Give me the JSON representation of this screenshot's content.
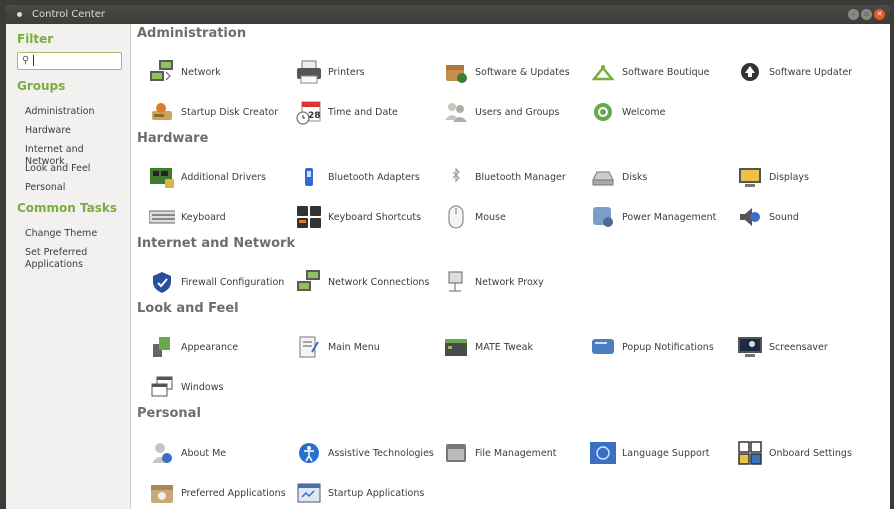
{
  "window": {
    "title": "Control Center"
  },
  "sidebar": {
    "filter_heading": "Filter",
    "search_value": "",
    "groups_heading": "Groups",
    "groups": [
      "Administration",
      "Hardware",
      "Internet and Network",
      "Look and Feel",
      "Personal"
    ],
    "tasks_heading": "Common Tasks",
    "tasks": [
      "Change Theme",
      "Set Preferred Applications"
    ]
  },
  "sections": [
    {
      "title": "Administration",
      "items": [
        {
          "label": "Network",
          "icon": "network-icon"
        },
        {
          "label": "Printers",
          "icon": "printer-icon"
        },
        {
          "label": "Software & Updates",
          "icon": "software-updates-icon"
        },
        {
          "label": "Software Boutique",
          "icon": "boutique-icon"
        },
        {
          "label": "Software Updater",
          "icon": "updater-icon"
        },
        {
          "label": "Startup Disk Creator",
          "icon": "startup-disk-icon"
        },
        {
          "label": "Time and Date",
          "icon": "calendar-clock-icon"
        },
        {
          "label": "Users and Groups",
          "icon": "users-icon"
        },
        {
          "label": "Welcome",
          "icon": "welcome-icon"
        }
      ]
    },
    {
      "title": "Hardware",
      "items": [
        {
          "label": "Additional Drivers",
          "icon": "drivers-icon"
        },
        {
          "label": "Bluetooth Adapters",
          "icon": "bluetooth-adapter-icon"
        },
        {
          "label": "Bluetooth Manager",
          "icon": "bluetooth-icon"
        },
        {
          "label": "Disks",
          "icon": "disks-icon"
        },
        {
          "label": "Displays",
          "icon": "display-icon"
        },
        {
          "label": "Keyboard",
          "icon": "keyboard-icon"
        },
        {
          "label": "Keyboard Shortcuts",
          "icon": "shortcuts-icon"
        },
        {
          "label": "Mouse",
          "icon": "mouse-icon"
        },
        {
          "label": "Power Management",
          "icon": "power-icon"
        },
        {
          "label": "Sound",
          "icon": "sound-icon"
        }
      ]
    },
    {
      "title": "Internet and Network",
      "items": [
        {
          "label": "Firewall Configuration",
          "icon": "firewall-icon"
        },
        {
          "label": "Network Connections",
          "icon": "network-connections-icon"
        },
        {
          "label": "Network Proxy",
          "icon": "proxy-icon"
        }
      ]
    },
    {
      "title": "Look and Feel",
      "items": [
        {
          "label": "Appearance",
          "icon": "appearance-icon"
        },
        {
          "label": "Main Menu",
          "icon": "main-menu-icon"
        },
        {
          "label": "MATE Tweak",
          "icon": "tweak-icon"
        },
        {
          "label": "Popup Notifications",
          "icon": "notifications-icon"
        },
        {
          "label": "Screensaver",
          "icon": "screensaver-icon"
        },
        {
          "label": "Windows",
          "icon": "windows-icon"
        }
      ]
    },
    {
      "title": "Personal",
      "items": [
        {
          "label": "About Me",
          "icon": "about-me-icon"
        },
        {
          "label": "Assistive Technologies",
          "icon": "accessibility-icon"
        },
        {
          "label": "File Management",
          "icon": "file-management-icon"
        },
        {
          "label": "Language Support",
          "icon": "language-icon"
        },
        {
          "label": "Onboard Settings",
          "icon": "onboard-icon"
        },
        {
          "label": "Preferred Applications",
          "icon": "preferred-apps-icon"
        },
        {
          "label": "Startup Applications",
          "icon": "startup-apps-icon"
        }
      ]
    }
  ],
  "colors": {
    "accent": "#7bac3e",
    "heading": "#6f6d6a",
    "titlebar": "#3c3b37",
    "close": "#e5582e"
  }
}
